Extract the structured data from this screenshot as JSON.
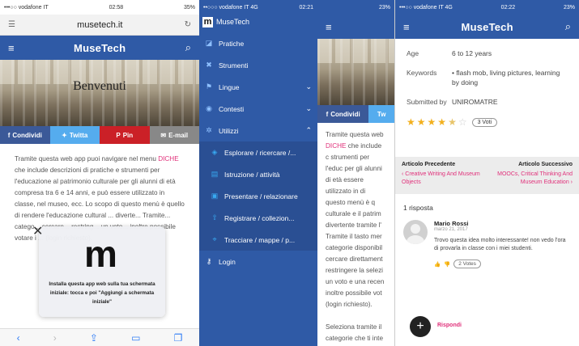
{
  "phone1": {
    "status": {
      "carrier": "•••○○ vodafone IT",
      "time": "02:58",
      "battery": "35%"
    },
    "url": "musetech.it",
    "app_title": "MuseTech",
    "hero_text": "Benvenuti",
    "shares": {
      "facebook": "Condividi",
      "twitter": "Twitta",
      "pin": "Pin",
      "email": "E-mail"
    },
    "body_before_link": "Tramite questa web app puoi navigare nel menu ",
    "body_link": "DICHE",
    "body_after_link": " che include descrizioni di pratiche e strumenti per l'educazione al patrimonio culturale per gli alunni di età compresa tra 6 e 14 anni, e può essere utilizzato in classe, nel museo, ecc. Lo scopo di questo menù è quello di rendere l'educazione cultural",
    "body_tail": "... diverte... Tramite... catego... cercare... restring... un voto... inoltre possibile votare i ... (login richiesto).",
    "popup": {
      "logo": "m",
      "message": "Installa questa app web sulla tua schermata iniziale: tocca e poi \"Aggiungi a schermata iniziale\""
    }
  },
  "phone2": {
    "status": {
      "carrier": "••○○○ vodafone IT 4G",
      "time": "02:21"
    },
    "brand": "MuseTech",
    "menu": [
      {
        "label": "Pratiche"
      },
      {
        "label": "Strumenti"
      },
      {
        "label": "Lingue"
      },
      {
        "label": "Contesti"
      },
      {
        "label": "Utilizzi"
      }
    ],
    "submenu": [
      {
        "label": "Esplorare / ricercare /..."
      },
      {
        "label": "Istruzione / attività"
      },
      {
        "label": "Presentare / relazionare"
      },
      {
        "label": "Registrare / collezion..."
      },
      {
        "label": "Tracciare / mappe / p..."
      }
    ],
    "login": "Login"
  },
  "phone3": {
    "status": {
      "battery": "23%"
    },
    "share_fb": "Condividi",
    "share_tw": "Tw",
    "text_before": "Tramite questa web ",
    "text_link": "DICHE",
    "text_after": " che include c strumenti per l'educ per gli alunni di età essere utilizzato in di questo menù è q culturale e il patrim divertente tramite l' Tramite il tasto mer categorie disponibil cercare direttament restringere la selezi un voto e una recen inoltre possibile vot (login richiesto).",
    "text_tail": "Seleziona tramite il categorie che ti inte"
  },
  "phone4": {
    "status": {
      "carrier": "•••○○ vodafone IT 4G",
      "time": "02:22",
      "battery": "23%"
    },
    "app_title": "MuseTech",
    "age_label": "Age",
    "age_value": "6 to 12 years",
    "keywords_label": "Keywords",
    "keywords_value": "• flash mob, living pictures, learning by doing",
    "submitted_label": "Submitted by",
    "submitted_value": "UNIROMATRE",
    "rating": 4.5,
    "votes": "3 Voti",
    "prev_header": "Articolo Precedente",
    "prev_link": "‹ Creative Writing And Museum Objects",
    "next_header": "Articolo Successivo",
    "next_link": "MOOCs, Critical Thinking And Museum Education ›",
    "replies": "1 risposta",
    "comment_author": "Mario Rossi",
    "comment_date": "marzo 21, 2017",
    "comment_text": "Trovo questa idea molto interessante! non vedo l'ora di provarla in classe con i miei studenti.",
    "comment_votes": "2 Votes",
    "reply_label": "Rispondi"
  },
  "colors": {
    "brand_blue": "#2f5aa6",
    "accent_pink": "#e0307a",
    "star": "#f2b01e"
  }
}
